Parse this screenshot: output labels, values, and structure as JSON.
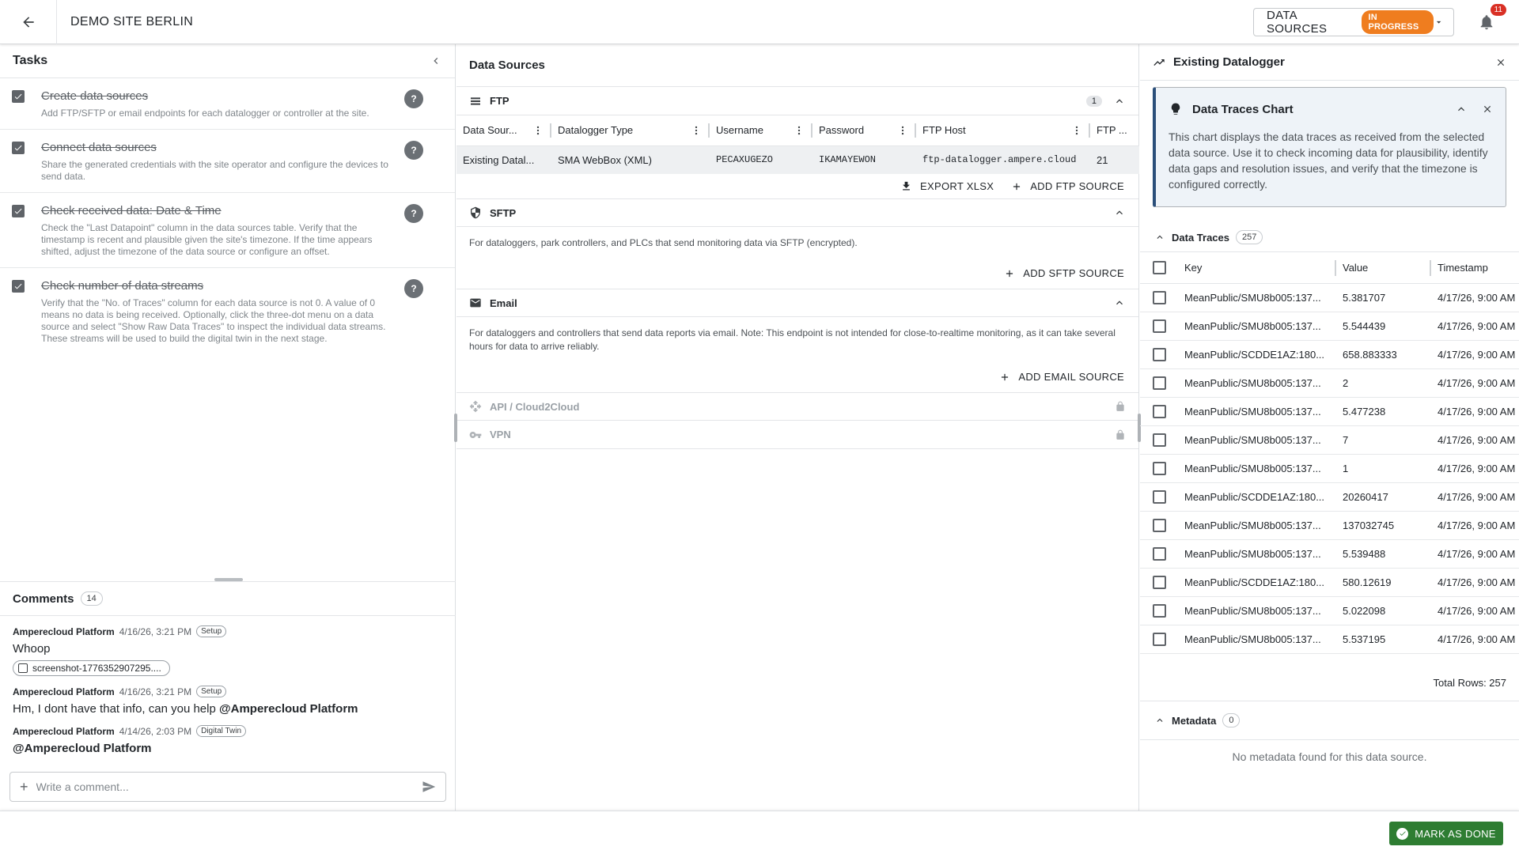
{
  "header": {
    "site_title": "DEMO SITE BERLIN",
    "stage_select_label": "DATA SOURCES",
    "stage_status": "IN PROGRESS",
    "notification_count": "11"
  },
  "tasks": {
    "title": "Tasks",
    "items": [
      {
        "title": "Create data sources",
        "desc": "Add FTP/SFTP or email endpoints for each datalogger or controller at the site."
      },
      {
        "title": "Connect data sources",
        "desc": "Share the generated credentials with the site operator and configure the devices to send data."
      },
      {
        "title": "Check received data: Date & Time",
        "desc": "Check the \"Last Datapoint\" column in the data sources table. Verify that the timestamp is recent and plausible given the site's timezone. If the time appears shifted, adjust the timezone of the data source or configure an offset."
      },
      {
        "title": "Check number of data streams",
        "desc": "Verify that the \"No. of Traces\" column for each data source is not 0. A value of 0 means no data is being received. Optionally, click the three-dot menu on a data source and select \"Show Raw Data Traces\" to inspect the individual data streams. These streams will be used to build the digital twin in the next stage."
      }
    ],
    "help_symbol": "?"
  },
  "comments": {
    "title": "Comments",
    "count": "14",
    "items": [
      {
        "author": "Amperecloud Platform",
        "time": "4/16/26, 3:21 PM",
        "tag": "Setup",
        "body": "Whoop",
        "attachment": "screenshot-1776352907295...."
      },
      {
        "author": "Amperecloud Platform",
        "time": "4/16/26, 3:21 PM",
        "tag": "Setup",
        "body": "Hm, I dont have that info, can you help ",
        "mention": "@Amperecloud Platform"
      },
      {
        "author": "Amperecloud Platform",
        "time": "4/14/26, 2:03 PM",
        "tag": "Digital Twin",
        "mention": "@Amperecloud Platform"
      }
    ],
    "input_placeholder": "Write a comment..."
  },
  "data_sources": {
    "title": "Data Sources",
    "ftp": {
      "name": "FTP",
      "count": "1",
      "columns": [
        "Data Sour...",
        "Datalogger Type",
        "Username",
        "Password",
        "FTP Host",
        "FTP ..."
      ],
      "rows": [
        [
          "Existing Datal...",
          "SMA WebBox (XML)",
          "PECAXUGEZO",
          "IKAMAYEWON",
          "ftp-datalogger.ampere.cloud",
          "21"
        ]
      ],
      "export_label": "EXPORT XLSX",
      "add_label": "ADD FTP SOURCE"
    },
    "sftp": {
      "name": "SFTP",
      "desc": "For dataloggers, park controllers, and PLCs that send monitoring data via SFTP (encrypted).",
      "add_label": "ADD SFTP SOURCE"
    },
    "email": {
      "name": "Email",
      "desc": "For dataloggers and controllers that send data reports via email. Note: This endpoint is not intended for close-to-realtime monitoring, as it can take several hours for data to arrive reliably.",
      "add_label": "ADD EMAIL SOURCE"
    },
    "api": {
      "name": "API / Cloud2Cloud"
    },
    "vpn": {
      "name": "VPN"
    }
  },
  "detail": {
    "title": "Existing Datalogger",
    "info_card": {
      "title": "Data Traces Chart",
      "text": "This chart displays the data traces as received from the selected data source. Use it to check incoming data for plausibility, identify data gaps and resolution issues, and verify that the timezone is configured correctly."
    },
    "traces": {
      "title": "Data Traces",
      "count": "257",
      "columns": [
        "Key",
        "Value",
        "Timestamp"
      ],
      "rows": [
        [
          "MeanPublic/SMU8b005:137...",
          "5.381707",
          "4/17/26, 9:00 AM"
        ],
        [
          "MeanPublic/SMU8b005:137...",
          "5.544439",
          "4/17/26, 9:00 AM"
        ],
        [
          "MeanPublic/SCDDE1AZ:180...",
          "658.883333",
          "4/17/26, 9:00 AM"
        ],
        [
          "MeanPublic/SMU8b005:137...",
          "2",
          "4/17/26, 9:00 AM"
        ],
        [
          "MeanPublic/SMU8b005:137...",
          "5.477238",
          "4/17/26, 9:00 AM"
        ],
        [
          "MeanPublic/SMU8b005:137...",
          "7",
          "4/17/26, 9:00 AM"
        ],
        [
          "MeanPublic/SMU8b005:137...",
          "1",
          "4/17/26, 9:00 AM"
        ],
        [
          "MeanPublic/SCDDE1AZ:180...",
          "20260417",
          "4/17/26, 9:00 AM"
        ],
        [
          "MeanPublic/SMU8b005:137...",
          "137032745",
          "4/17/26, 9:00 AM"
        ],
        [
          "MeanPublic/SMU8b005:137...",
          "5.539488",
          "4/17/26, 9:00 AM"
        ],
        [
          "MeanPublic/SCDDE1AZ:180...",
          "580.12619",
          "4/17/26, 9:00 AM"
        ],
        [
          "MeanPublic/SMU8b005:137...",
          "5.022098",
          "4/17/26, 9:00 AM"
        ],
        [
          "MeanPublic/SMU8b005:137...",
          "5.537195",
          "4/17/26, 9:00 AM"
        ]
      ],
      "total_rows": "Total Rows: 257"
    },
    "metadata": {
      "title": "Metadata",
      "count": "0",
      "empty_text": "No metadata found for this data source."
    }
  },
  "footer": {
    "mark_done_label": "MARK AS DONE"
  }
}
